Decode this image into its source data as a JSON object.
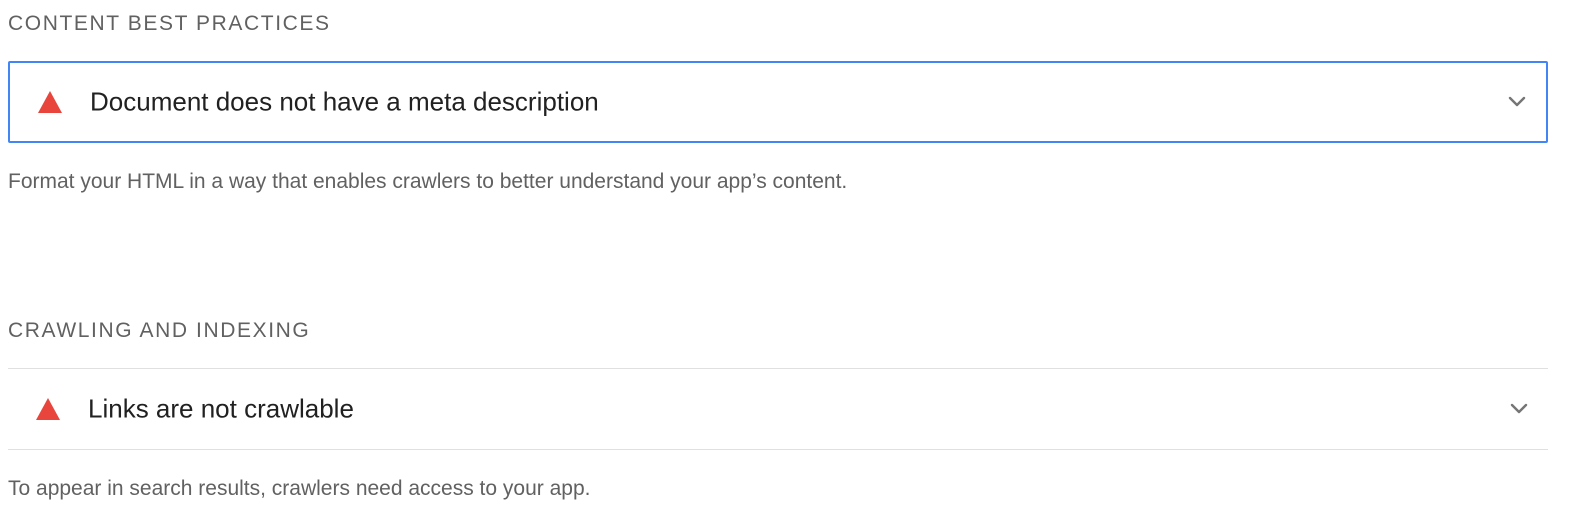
{
  "groups": [
    {
      "title": "CONTENT BEST PRACTICES",
      "audit": {
        "status_icon": "fail-triangle-icon",
        "title": "Document does not have a meta description",
        "expand_icon": "chevron-down-icon"
      },
      "description": "Format your HTML in a way that enables crawlers to better understand your app’s content."
    },
    {
      "title": "CRAWLING AND INDEXING",
      "audit": {
        "status_icon": "fail-triangle-icon",
        "title": "Links are not crawlable",
        "expand_icon": "chevron-down-icon"
      },
      "description": "To appear in search results, crawlers need access to your app."
    }
  ],
  "colors": {
    "fail": "#e8453c",
    "focus": "#4285f4",
    "muted_text": "#616161",
    "divider": "#e0e0e0"
  }
}
